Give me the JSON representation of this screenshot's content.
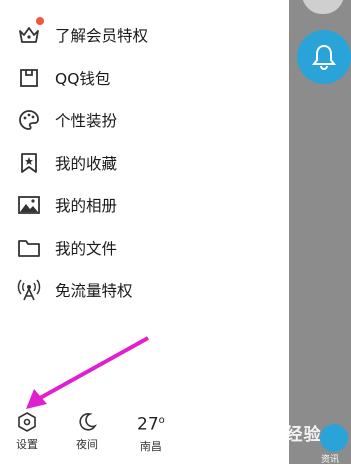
{
  "menu": {
    "items": [
      {
        "label": "了解会员特权",
        "icon": "vip-crown-icon",
        "badge": "red-dot"
      },
      {
        "label": "QQ钱包",
        "icon": "wallet-icon"
      },
      {
        "label": "个性装扮",
        "icon": "palette-icon"
      },
      {
        "label": "我的收藏",
        "icon": "bookmark-star-icon"
      },
      {
        "label": "我的相册",
        "icon": "image-icon"
      },
      {
        "label": "我的文件",
        "icon": "folder-icon"
      },
      {
        "label": "免流量特权",
        "icon": "antenna-icon"
      }
    ]
  },
  "bottom_bar": {
    "settings_label": "设置",
    "night_label": "夜间",
    "weather_temp": "27",
    "weather_unit": "o",
    "weather_city": "南昌"
  },
  "overlay": {
    "news_label": "资讯"
  },
  "colors": {
    "accent_blue": "#2aa3d8",
    "badge_red": "#f5553b",
    "annotation_arrow": "#e020d0"
  },
  "watermark": "Baidu经验"
}
